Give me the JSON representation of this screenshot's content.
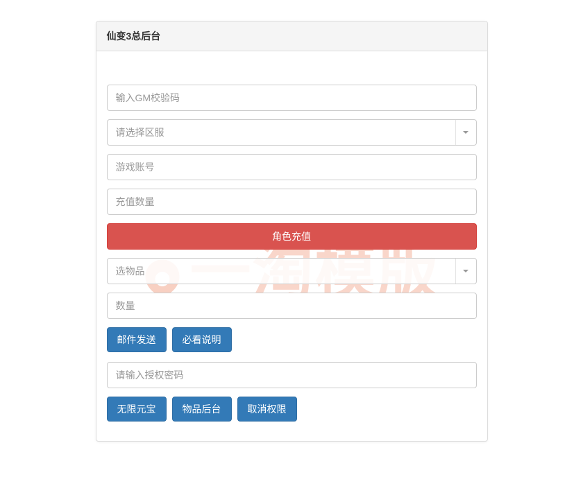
{
  "panel": {
    "title": "仙变3总后台"
  },
  "form": {
    "gm_code_placeholder": "输入GM校验码",
    "server_select_placeholder": "请选择区服",
    "account_placeholder": "游戏账号",
    "recharge_amount_placeholder": "充值数量",
    "recharge_button": "角色充值",
    "item_select_placeholder": "选物品",
    "quantity_placeholder": "数量",
    "send_mail_button": "邮件发送",
    "must_read_button": "必看说明",
    "auth_password_placeholder": "请输入授权密码",
    "unlimited_gold_button": "无限元宝",
    "item_backend_button": "物品后台",
    "cancel_permission_button": "取消权限"
  },
  "watermark": {
    "text": "一淘模版"
  }
}
